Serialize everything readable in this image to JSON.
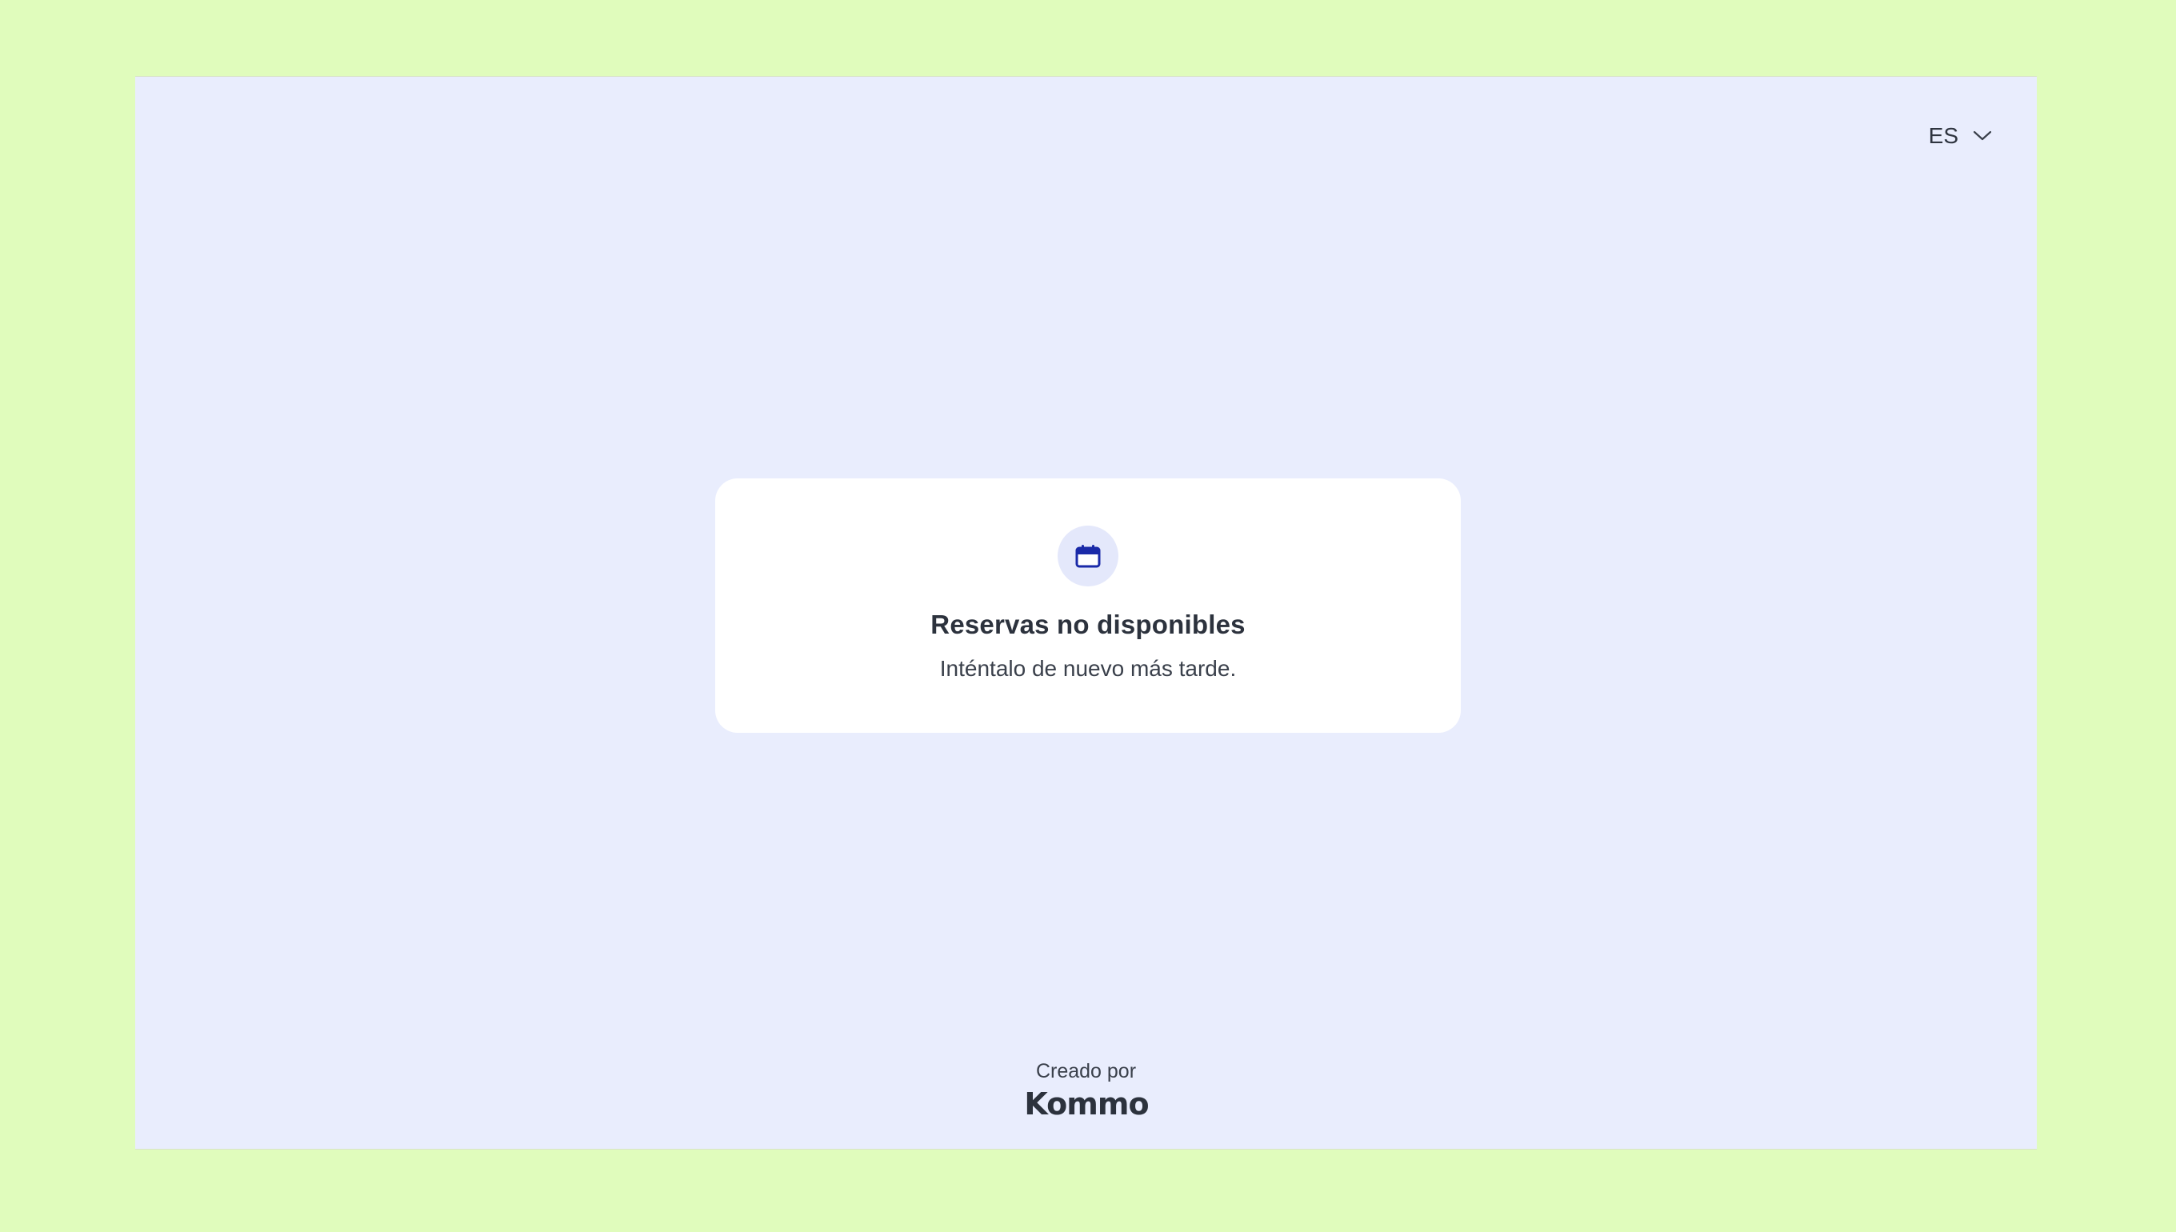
{
  "language_selector": {
    "value": "ES",
    "icon": "chevron-down-icon"
  },
  "notice": {
    "icon": "calendar-icon",
    "title": "Reservas no disponibles",
    "message": "Inténtalo de nuevo más tarde."
  },
  "footer": {
    "created_by": "Creado por",
    "brand": "Kommo"
  },
  "colors": {
    "outer_background": "#e0fcbc",
    "page_background": "#e9edfd",
    "card_background": "#ffffff",
    "icon_accent": "#1a2aa8",
    "text": "#2c323d"
  }
}
